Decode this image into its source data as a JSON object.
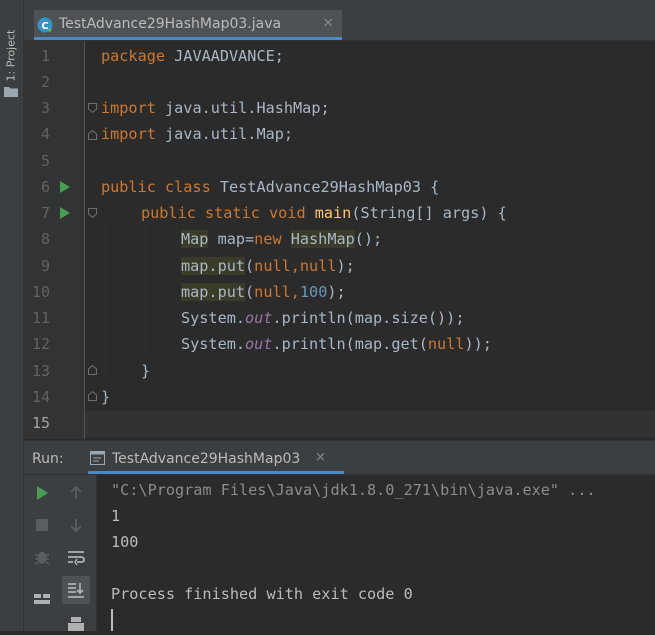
{
  "sidebar": {
    "project_label": "1: Project"
  },
  "editor_tab": {
    "label": "TestAdvance29HashMap03.java",
    "close": "×"
  },
  "editor": {
    "line_numbers": [
      "1",
      "2",
      "3",
      "4",
      "5",
      "6",
      "7",
      "8",
      "9",
      "10",
      "11",
      "12",
      "13",
      "14",
      "15"
    ],
    "lines": {
      "l1": {
        "kw": "package",
        "rest": " JAVAADVANCE;"
      },
      "l3": {
        "kw": "import",
        "rest": " java.util.HashMap;"
      },
      "l4": {
        "kw": "import",
        "rest": " java.util.Map;"
      },
      "l6": {
        "kw": "public class",
        "rest": " TestAdvance29HashMap03 {"
      },
      "l7": {
        "kw": "public static void",
        "fn": "main",
        "rest": "(String[] args) {"
      },
      "l8": {
        "type": "Map",
        "mid": " map=",
        "kw": "new",
        "sp": " ",
        "ctor": "HashMap",
        "rest": "();"
      },
      "l9": {
        "obj": "map.put",
        "open": "(",
        "a": "null",
        "comma": ",",
        "b": "null",
        "close": ");"
      },
      "l10": {
        "obj": "map.put",
        "open": "(",
        "a": "null",
        "comma": ",",
        "b": "100",
        "close": ");"
      },
      "l11": {
        "pre": "System.",
        "field": "out",
        "rest": ".println(map.size());"
      },
      "l12": {
        "pre": "System.",
        "field": "out",
        "mid": ".println(map.get(",
        "kw": "null",
        "rest": "));"
      },
      "l13": {
        "text": "}"
      },
      "l14": {
        "text": "}"
      }
    }
  },
  "run_panel": {
    "label": "Run:",
    "tab_label": "TestAdvance29HashMap03",
    "tab_close": "×",
    "output": [
      "\"C:\\Program Files\\Java\\jdk1.8.0_271\\bin\\java.exe\" ...",
      "1",
      "100",
      "",
      "Process finished with exit code 0"
    ]
  },
  "colors": {
    "run_green": "#499c54",
    "accent_blue": "#4a88c7",
    "keyword": "#cc7832",
    "number": "#6897bb"
  }
}
